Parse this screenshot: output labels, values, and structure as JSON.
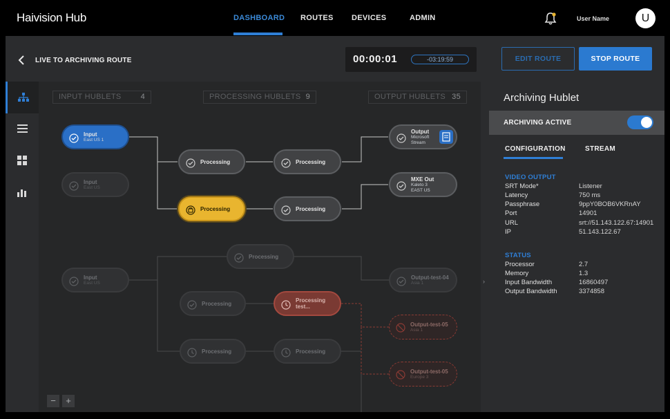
{
  "app": {
    "brand": "Haivision Hub",
    "user_name": "User Name",
    "avatar_letter": "U"
  },
  "nav": {
    "items": [
      "DASHBOARD",
      "ROUTES",
      "DEVICES",
      "ADMIN"
    ],
    "active": "DASHBOARD"
  },
  "route": {
    "title": "LIVE TO ARCHIVING ROUTE",
    "timer": "00:00:01",
    "countdown": "-03:19:59",
    "edit_label": "EDIT ROUTE",
    "stop_label": "STOP ROUTE"
  },
  "columns": {
    "input": {
      "label": "INPUT HUBLETS",
      "count": "4"
    },
    "processing": {
      "label": "PROCESSING HUBLETS",
      "count": "9"
    },
    "output": {
      "label": "OUTPUT HUBLETS",
      "count": "35"
    }
  },
  "nodes": {
    "in1": {
      "t1": "Input",
      "t2": "East US 1"
    },
    "in2": {
      "t1": "Input",
      "t2": "East US"
    },
    "in3": {
      "t1": "Input",
      "t2": "East US"
    },
    "p1": {
      "t1": "Processing"
    },
    "p2": {
      "t1": "Processing"
    },
    "p3": {
      "t1": "Processing"
    },
    "p4": {
      "t1": "Processing"
    },
    "p5": {
      "t1": "Processing"
    },
    "p6": {
      "t1": "Processing"
    },
    "p7": {
      "t1": "Processing test..."
    },
    "p8": {
      "t1": "Processing"
    },
    "p9": {
      "t1": "Processing"
    },
    "o1": {
      "t1": "Output",
      "t2a": "Microsoft",
      "t2b": "Stream"
    },
    "o2": {
      "t1": "MXE Out",
      "t2a": "Kaleto 3",
      "t2b": "EAST US"
    },
    "o3": {
      "t1": "Output-test-04",
      "t2": "Asia 1"
    },
    "o4": {
      "t1": "Output-test-05",
      "t2": "Asia 1"
    },
    "o5": {
      "t1": "Output-test-05",
      "t2": "Europe 3"
    }
  },
  "zoom": {
    "out": "−",
    "in": "+"
  },
  "panel": {
    "title": "Archiving Hublet",
    "archiving_label": "ARCHIVING ACTIVE",
    "archiving_on": true,
    "tabs": [
      "CONFIGURATION",
      "STREAM"
    ],
    "video_output_heading": "VIDEO OUTPUT",
    "video_output": [
      {
        "k": "SRT Mode*",
        "v": "Listener"
      },
      {
        "k": "Latency",
        "v": "750 ms"
      },
      {
        "k": "Passphrase",
        "v": "9ppY0BOB6VKRnAY"
      },
      {
        "k": "Port",
        "v": "14901"
      },
      {
        "k": "URL",
        "v": "srt://51.143.122.67:14901"
      },
      {
        "k": "IP",
        "v": "51.143.122.67"
      }
    ],
    "status_heading": "STATUS",
    "status": [
      {
        "k": "Processor",
        "v": "2.7"
      },
      {
        "k": "Memory",
        "v": "1.3"
      },
      {
        "k": "Input Bandwidth",
        "v": "16860497"
      },
      {
        "k": "Output Bandwidth",
        "v": "3374858"
      }
    ]
  },
  "colors": {
    "accent": "#2f7fd6",
    "highlight": "#e9b52f",
    "error": "#a4493f"
  }
}
